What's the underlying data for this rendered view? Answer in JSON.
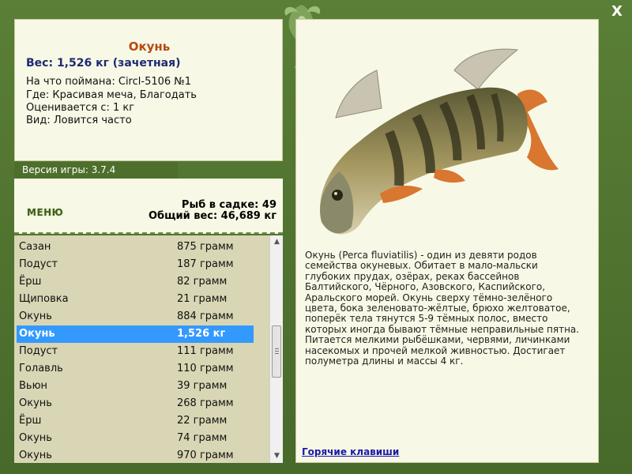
{
  "window": {
    "close_label": "X"
  },
  "fish": {
    "name": "Окунь",
    "weight_line": "Вес: 1,526 кг (зачетная)",
    "details": [
      "На что поймана: Circl-5106 №1",
      "Где: Красивая меча, Благодать",
      "Оценивается с: 1 кг",
      "Вид: Ловится часто"
    ],
    "description": "Окунь (Perca fluviatilis) - один из девяти родов семейства окуневых. Обитает в мало-мальски глубоких прудах, озёрах, реках бассейнов Балтийского, Чёрного, Азовского, Каспийского, Аральского морей. Окунь сверху тёмно-зелёного цвета, бока зеленовато-жёлтые, брюхо желтоватое, поперёк тела тянутся 5-9 тёмных полос, вместо которых иногда бывают тёмные неправильные пятна. Питается мелкими рыбёшками, червями, личинками насекомых и прочей мелкой живностью. Достигает полуметра длины и массы 4 кг."
  },
  "version": "Версия игры: 3.7.4",
  "menu_label": "МЕНЮ",
  "keepnet": {
    "count": "Рыб в садке: 49",
    "total": "Общий вес: 46,689 кг"
  },
  "catch_list": [
    {
      "name": "Сазан",
      "weight": "875 грамм",
      "selected": false
    },
    {
      "name": "Подуст",
      "weight": "187 грамм",
      "selected": false
    },
    {
      "name": "Ёрш",
      "weight": "82 грамм",
      "selected": false
    },
    {
      "name": "Щиповка",
      "weight": "21 грамм",
      "selected": false
    },
    {
      "name": "Окунь",
      "weight": "884 грамм",
      "selected": false
    },
    {
      "name": "Окунь",
      "weight": "1,526 кг",
      "selected": true
    },
    {
      "name": "Подуст",
      "weight": "111 грамм",
      "selected": false
    },
    {
      "name": "Голавль",
      "weight": "110 грамм",
      "selected": false
    },
    {
      "name": "Вьюн",
      "weight": "39 грамм",
      "selected": false
    },
    {
      "name": "Окунь",
      "weight": "268 грамм",
      "selected": false
    },
    {
      "name": "Ёрш",
      "weight": "22 грамм",
      "selected": false
    },
    {
      "name": "Окунь",
      "weight": "74 грамм",
      "selected": false
    },
    {
      "name": "Окунь",
      "weight": "970 грамм",
      "selected": false
    }
  ],
  "hotkeys_label": "Горячие клавиши",
  "colors": {
    "frame_green": "#4a6f2c",
    "panel_bg": "#f8f8e6",
    "list_bg": "#d8d6b4",
    "selection": "#3399ff",
    "title_orange": "#b6490f",
    "weight_blue": "#1d2a73"
  }
}
